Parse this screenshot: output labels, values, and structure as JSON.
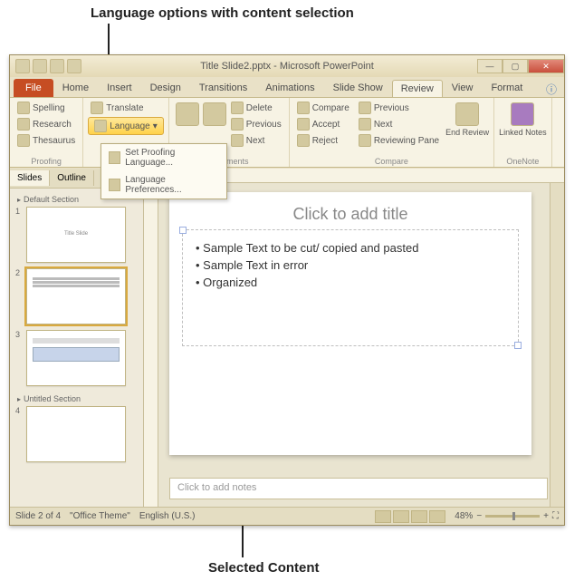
{
  "annotations": {
    "top": "Language options with content selection",
    "bottom": "Selected Content"
  },
  "window": {
    "title": "Title Slide2.pptx - Microsoft PowerPoint"
  },
  "ribbon": {
    "tabs": [
      "File",
      "Home",
      "Insert",
      "Design",
      "Transitions",
      "Animations",
      "Slide Show",
      "Review",
      "View",
      "Format"
    ],
    "active": "Review",
    "proofing": {
      "spelling": "Spelling",
      "research": "Research",
      "thesaurus": "Thesaurus",
      "label": "Proofing"
    },
    "language": {
      "translate": "Translate",
      "language_btn": "Language",
      "label": "Language",
      "menu": {
        "set": "Set Proofing Language...",
        "prefs": "Language Preferences..."
      }
    },
    "comments": {
      "new": "New Comment",
      "delete": "Delete",
      "prev": "Previous",
      "next": "Next",
      "label": "Comments"
    },
    "compare": {
      "compare": "Compare",
      "accept": "Accept",
      "reject": "Reject",
      "reviewing": "Reviewing Pane",
      "previous": "Previous",
      "next": "Next",
      "end": "End Review",
      "label": "Compare"
    },
    "onenote": {
      "linked": "Linked Notes",
      "label": "OneNote"
    }
  },
  "side": {
    "tabs": {
      "slides": "Slides",
      "outline": "Outline"
    },
    "sections": {
      "default": "Default Section",
      "untitled": "Untitled Section"
    },
    "thumb1_text": "Title Slide",
    "thumb2_lines": [
      "Sample Text to be cut/ copied",
      "Sample Text in error",
      "Organized"
    ]
  },
  "slide": {
    "title_placeholder": "Click to add title",
    "bullets": [
      "Sample Text to be cut/ copied and pasted",
      "Sample Text in error",
      "Organized"
    ],
    "notes_placeholder": "Click to add notes"
  },
  "status": {
    "slide_info": "Slide 2 of 4",
    "theme": "\"Office Theme\"",
    "lang": "English (U.S.)",
    "zoom": "48%"
  }
}
